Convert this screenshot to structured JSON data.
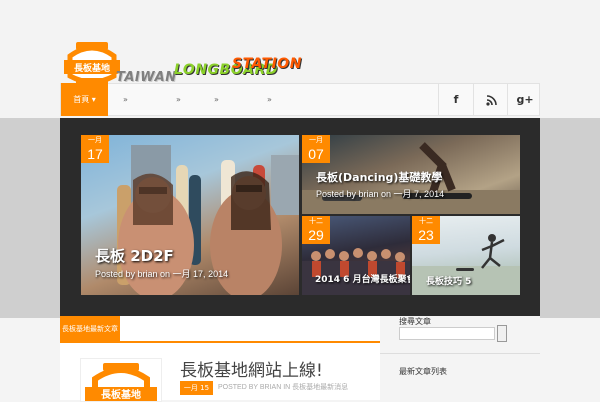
{
  "brand": {
    "logo_text": "長板基地",
    "word1": "TAIWAN",
    "word2": "LONGBOARD",
    "word3": "STATION",
    "accent": "#ff8a00"
  },
  "nav": {
    "home_label": "首頁 ▾",
    "items": [
      "»",
      "»",
      "»",
      "»"
    ],
    "social": [
      "f",
      "rss-icon",
      "g+"
    ]
  },
  "slides": {
    "main": {
      "month": "一月",
      "day": "17",
      "title": "長板 2D2F",
      "meta": "Posted by brian on 一月 17, 2014"
    },
    "dance": {
      "month": "一月",
      "day": "07",
      "title": "長板(Dancing)基礎教學",
      "meta": "Posted by brian on 一月 7, 2014"
    },
    "group": {
      "month": "十二",
      "day": "29",
      "title": "2014 6 月台灣長板聚會"
    },
    "jump": {
      "month": "十二",
      "day": "23",
      "title": "長板技巧 5"
    }
  },
  "content": {
    "category_tab": "長板基地最新文章",
    "post_title": "長板基地網站上線!",
    "post_date": "一月 15",
    "post_meta": "POSTED BY BRIAN IN 長板基地最新消息"
  },
  "sidebar": {
    "search_title": "搜尋文章",
    "recent_title": "最新文章列表"
  }
}
